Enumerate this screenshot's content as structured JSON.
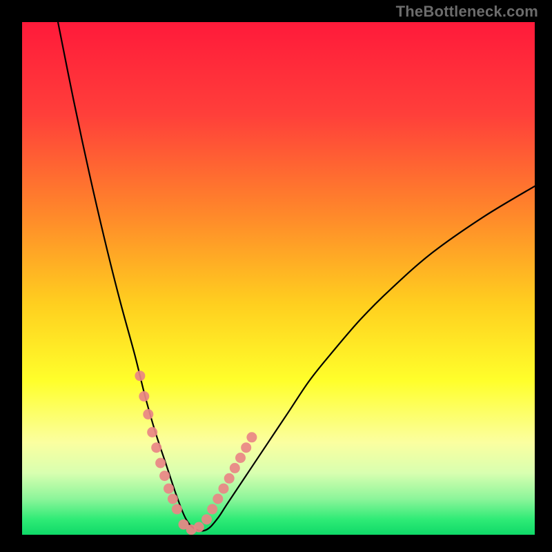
{
  "watermark": "TheBottleneck.com",
  "chart_data": {
    "type": "line",
    "title": "",
    "xlabel": "",
    "ylabel": "",
    "ylim": [
      0,
      100
    ],
    "xlim": [
      0,
      100
    ],
    "x_trough": 33,
    "series": [
      {
        "name": "bottleneck-curve",
        "x": [
          7,
          10,
          13,
          16,
          19,
          22,
          24,
          26,
          28,
          30,
          32,
          34,
          36,
          38,
          40,
          44,
          48,
          52,
          56,
          60,
          66,
          72,
          80,
          90,
          100
        ],
        "y": [
          100,
          85,
          71,
          58,
          46,
          35,
          27,
          20,
          14,
          8,
          3,
          1,
          1,
          3,
          6,
          12,
          18,
          24,
          30,
          35,
          42,
          48,
          55,
          62,
          68
        ]
      }
    ],
    "green_band": {
      "y_from": 0,
      "y_to": 5
    },
    "highlight_dots": {
      "name": "pink-dots",
      "x": [
        23.0,
        23.8,
        24.6,
        25.4,
        26.2,
        27.0,
        27.8,
        28.6,
        29.4,
        30.2,
        31.5,
        33.0,
        34.5,
        36.0,
        37.1,
        38.2,
        39.3,
        40.4,
        41.5,
        42.6,
        43.7,
        44.8
      ],
      "y": [
        31.0,
        27.0,
        23.5,
        20.0,
        17.0,
        14.0,
        11.5,
        9.0,
        7.0,
        5.0,
        2.0,
        1.0,
        1.5,
        3.0,
        5.0,
        7.0,
        9.0,
        11.0,
        13.0,
        15.0,
        17.0,
        19.0
      ]
    },
    "gradient_stops": [
      {
        "offset": 0.0,
        "color": "#ff1a3a"
      },
      {
        "offset": 0.18,
        "color": "#ff3f3a"
      },
      {
        "offset": 0.38,
        "color": "#ff8a2a"
      },
      {
        "offset": 0.55,
        "color": "#ffcf1f"
      },
      {
        "offset": 0.7,
        "color": "#ffff2b"
      },
      {
        "offset": 0.82,
        "color": "#fbffa0"
      },
      {
        "offset": 0.88,
        "color": "#d8ffb0"
      },
      {
        "offset": 0.93,
        "color": "#8cf59a"
      },
      {
        "offset": 0.97,
        "color": "#2feb76"
      },
      {
        "offset": 1.0,
        "color": "#0fd968"
      }
    ]
  }
}
